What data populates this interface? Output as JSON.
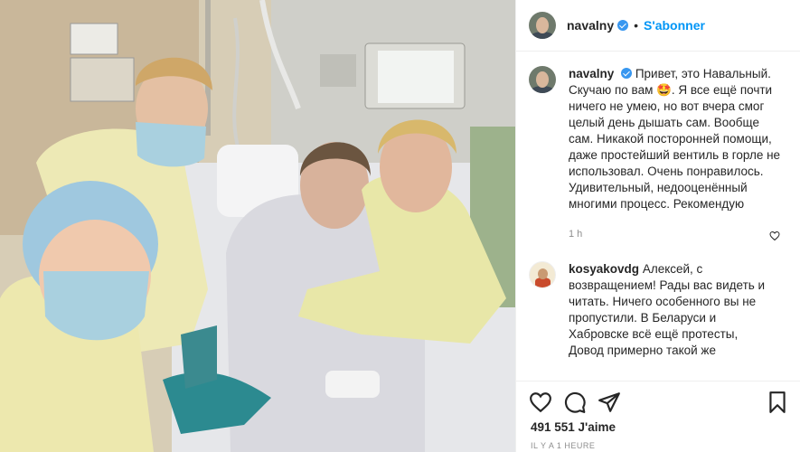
{
  "post": {
    "username": "navalny",
    "dot": "•",
    "follow_label": "S'abonner"
  },
  "caption": {
    "username": "navalny",
    "text": "Привет, это Навальный. Скучаю по вам 🤩. Я все ещё почти ничего не умею, но вот вчера смог целый день дышать сам. Вообще сам. Никакой посторонней помощи, даже простейший вентиль в горле не использовал. Очень понравилось. Удивительный, недооценённый многими процесс. Рекомендую",
    "time": "1 h"
  },
  "comment": {
    "username": "kosyakovdg",
    "text": "Алексей, с возвращением! Рады вас видеть и читать. Ничего особенного вы не пропустили. В Беларуси и Хабровске всё ещё протесты, Довод примерно такой же"
  },
  "stats": {
    "likes": "491 551 J'aime",
    "time_ago": "IL Y A 1 HEURE"
  },
  "icons": {
    "like": "heart-icon",
    "comment": "comment-icon",
    "share": "share-icon",
    "save": "bookmark-icon"
  },
  "colors": {
    "link": "#0095f6",
    "verified": "#3897f0",
    "muted": "#8e8e8e"
  }
}
